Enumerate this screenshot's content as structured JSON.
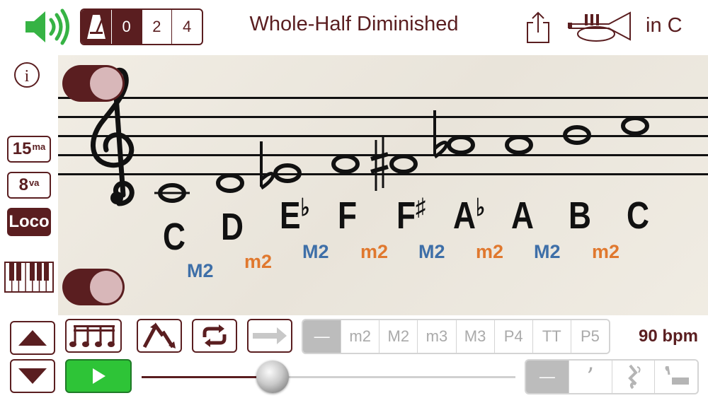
{
  "header": {
    "metronome_options": [
      "0",
      "2",
      "4"
    ],
    "metronome_selected": "0",
    "title": "Whole-Half Diminished",
    "key_label": "in C"
  },
  "staff": {
    "notes": [
      {
        "name": "C",
        "accidental": ""
      },
      {
        "name": "D",
        "accidental": ""
      },
      {
        "name": "E",
        "accidental": "♭"
      },
      {
        "name": "F",
        "accidental": ""
      },
      {
        "name": "F",
        "accidental": "♯"
      },
      {
        "name": "A",
        "accidental": "♭"
      },
      {
        "name": "A",
        "accidental": ""
      },
      {
        "name": "B",
        "accidental": ""
      },
      {
        "name": "C",
        "accidental": ""
      }
    ],
    "intervals": [
      "M2",
      "m2",
      "M2",
      "m2",
      "M2",
      "m2",
      "M2",
      "m2"
    ]
  },
  "left_column": {
    "octave_15": {
      "main": "15",
      "sup": "ma"
    },
    "octave_8": {
      "main": "8",
      "sup": "va"
    },
    "loco": "Loco"
  },
  "interval_selector": {
    "options": [
      "—",
      "m2",
      "M2",
      "m3",
      "M3",
      "P4",
      "TT",
      "P5"
    ],
    "selected": "—"
  },
  "tempo": {
    "bpm_label": "90 bpm",
    "slider_fraction": 0.35
  },
  "rest_selector": {
    "options": [
      "—",
      "’",
      "𝄽",
      "𝄼"
    ],
    "selected": "—"
  },
  "colors": {
    "accent": "#5a1e20",
    "speaker": "#36b344",
    "play": "#2ec437",
    "major_second": "#3e6fa8",
    "minor_second": "#e0782e"
  }
}
